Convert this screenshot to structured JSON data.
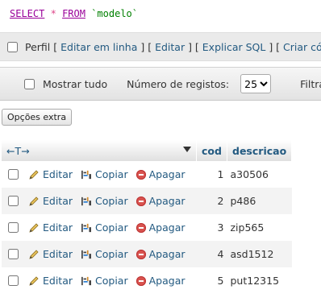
{
  "sql": {
    "kw1": "SELECT",
    "star": "*",
    "kw2": "FROM",
    "table": "`modelo`"
  },
  "linkbar": {
    "profile": "Perfil",
    "edit_inline": "Editar em linha",
    "edit": "Editar",
    "explain": "Explicar SQL",
    "create_code": "Criar código"
  },
  "navbar": {
    "show_all": "Mostrar tudo",
    "rows_label": "Número de registos:",
    "rows_value": "25",
    "rows_options": [
      "25"
    ],
    "filter": "Filtrar"
  },
  "options_button": "Opções extra",
  "table": {
    "arrows": "←T→",
    "columns": [
      "cod",
      "descricao"
    ],
    "action_labels": {
      "edit": "Editar",
      "copy": "Copiar",
      "delete": "Apagar"
    },
    "rows": [
      {
        "cod": "1",
        "descricao": "a30506"
      },
      {
        "cod": "2",
        "descricao": "p486"
      },
      {
        "cod": "3",
        "descricao": "zip565"
      },
      {
        "cod": "4",
        "descricao": "asd1512"
      },
      {
        "cod": "5",
        "descricao": "put12315"
      }
    ]
  }
}
